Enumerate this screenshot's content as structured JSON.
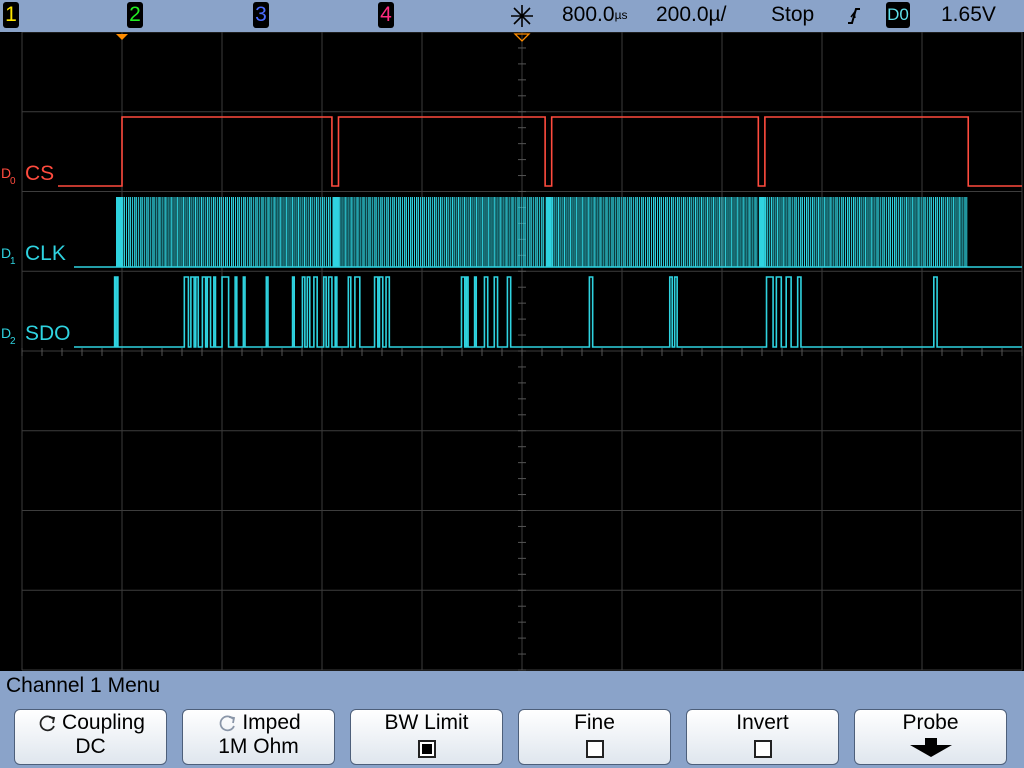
{
  "topbar": {
    "channels": [
      {
        "label": "1",
        "color": "#ffe600"
      },
      {
        "label": "2",
        "color": "#22ee22"
      },
      {
        "label": "3",
        "color": "#4b6cff"
      },
      {
        "label": "4",
        "color": "#ff2a7f"
      }
    ],
    "acq_icon": "acquisition-icon",
    "delay_value": "800.0",
    "delay_unit": "µs",
    "timebase": "200.0µ/",
    "run_state": "Stop",
    "trigger_slope_icon": "rising-edge-icon",
    "trigger_source": "D0",
    "trigger_level": "1.65V"
  },
  "traces": {
    "colors": {
      "cs": "#ff4b3e",
      "digital": "#2fd3e0"
    },
    "labels": [
      {
        "prefix": "D",
        "sub": "0",
        "name": "CS",
        "color": "#ff4b3e"
      },
      {
        "prefix": "D",
        "sub": "1",
        "name": "CLK",
        "color": "#2fd3e0"
      },
      {
        "prefix": "D",
        "sub": "2",
        "name": "SDO",
        "color": "#2fd3e0"
      }
    ],
    "cs_high_windows_us": [
      [
        0,
        1280
      ],
      [
        1320,
        2580
      ],
      [
        2620,
        3880
      ],
      [
        3920,
        5160
      ]
    ],
    "clk_bursts_us": [
      [
        0,
        1280
      ],
      [
        1320,
        2580
      ],
      [
        2620,
        3880
      ],
      [
        3920,
        5160
      ]
    ],
    "sdo_high_intervals_us": [
      [
        -45,
        -40
      ],
      [
        -30,
        -25
      ],
      [
        380,
        405
      ],
      [
        420,
        440
      ],
      [
        450,
        465
      ],
      [
        490,
        510
      ],
      [
        520,
        540
      ],
      [
        560,
        570
      ],
      [
        610,
        650
      ],
      [
        690,
        700
      ],
      [
        740,
        750
      ],
      [
        880,
        890
      ],
      [
        1040,
        1050
      ],
      [
        1100,
        1115
      ],
      [
        1130,
        1145
      ],
      [
        1170,
        1190
      ],
      [
        1230,
        1245
      ],
      [
        1260,
        1280
      ],
      [
        1300,
        1310
      ],
      [
        1380,
        1395
      ],
      [
        1420,
        1450
      ],
      [
        1540,
        1560
      ],
      [
        1570,
        1590
      ],
      [
        1610,
        1630
      ],
      [
        2070,
        2090
      ],
      [
        2100,
        2110
      ],
      [
        2150,
        2160
      ],
      [
        2210,
        2230
      ],
      [
        2270,
        2290
      ],
      [
        2350,
        2370
      ],
      [
        2850,
        2870
      ],
      [
        3340,
        3355
      ],
      [
        3370,
        3385
      ],
      [
        3930,
        3970
      ],
      [
        3990,
        4020
      ],
      [
        4050,
        4080
      ],
      [
        4120,
        4140
      ],
      [
        4950,
        4970
      ]
    ]
  },
  "menu": {
    "title": "Channel 1  Menu",
    "softkeys": [
      {
        "label": "Coupling",
        "value": "DC",
        "icon": "cycle-arrow-icon"
      },
      {
        "label": "Imped",
        "value": "1M Ohm",
        "icon": "cycle-arrow-icon"
      },
      {
        "label": "BW Limit",
        "checked": true
      },
      {
        "label": "Fine",
        "checked": false
      },
      {
        "label": "Invert",
        "checked": false
      },
      {
        "label": "Probe",
        "icon": "down-arrow-icon"
      }
    ]
  }
}
